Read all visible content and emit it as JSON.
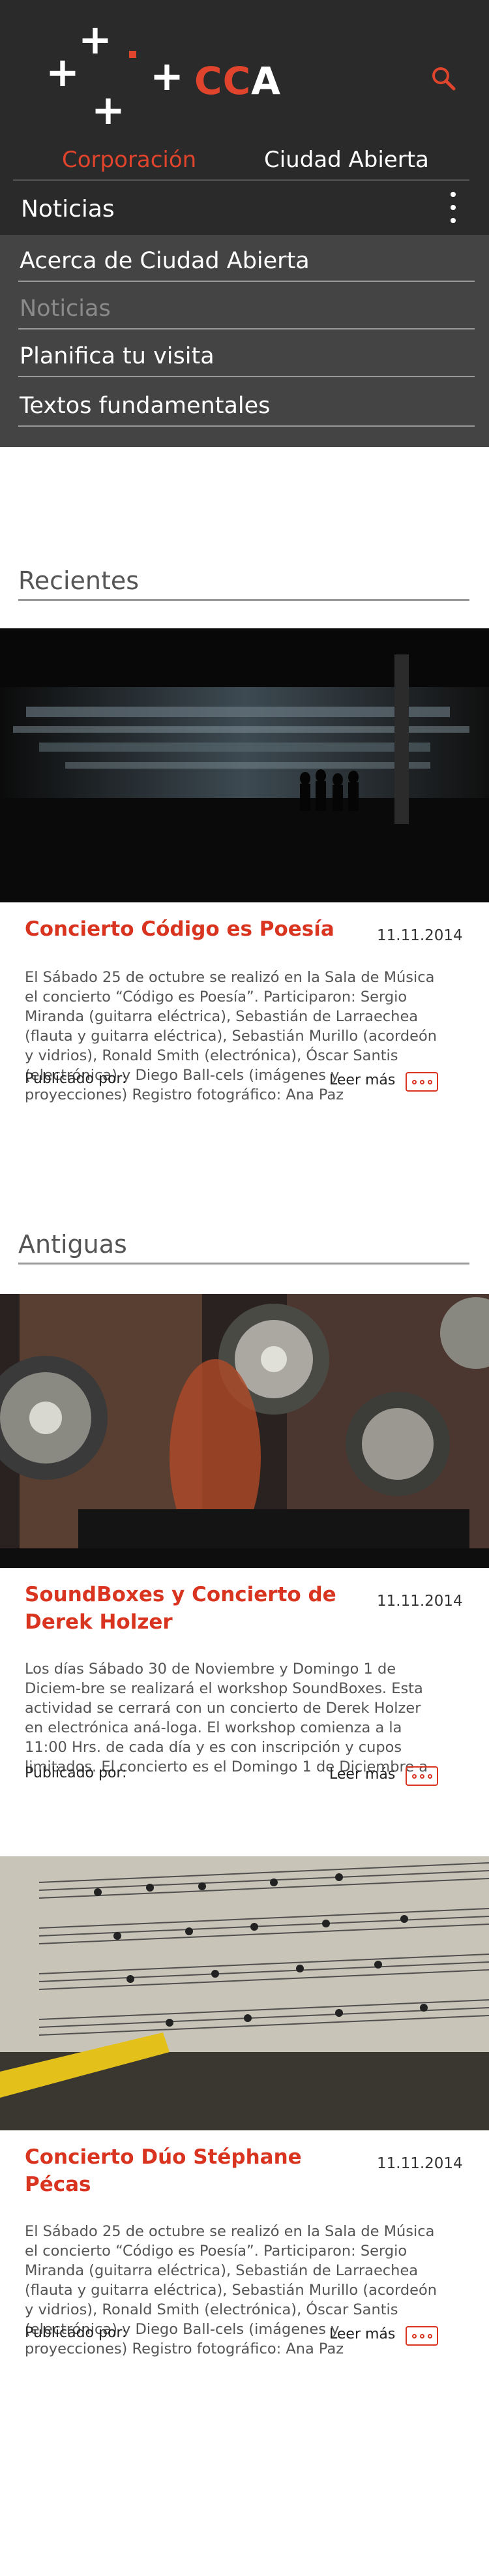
{
  "brand": {
    "logo_text_red": "CC",
    "logo_text_white": "A",
    "accent_color": "#e0442c"
  },
  "nav": {
    "tabs": [
      {
        "label": "Corporación"
      },
      {
        "label": "Ciudad Abierta"
      }
    ],
    "section_label": "Noticias",
    "menu": [
      {
        "label": "Acerca de Ciudad Abierta"
      },
      {
        "label": "Noticias"
      },
      {
        "label": "Planifica tu visita"
      },
      {
        "label": "Textos fundamentales"
      }
    ]
  },
  "groups": {
    "recent": "Recientes",
    "older": "Antiguas"
  },
  "posts": [
    {
      "title": "Concierto Código es Poesía",
      "date": "11.11.2014",
      "excerpt": "El Sábado 25 de octubre se realizó en la Sala de Música el concierto “Código es Poesía”. Participaron: Sergio Miranda (guitarra eléctrica), Sebastián de Larraechea (flauta y guitarra eléctrica), Sebastián Murillo (acordeón y vidrios), Ronald Smith (electrónica), Óscar Santis (electrónica) y Diego Ball-cels (imágenes y proyecciones) Registro fotográfico: Ana Paz",
      "published_label": "Publicado por:",
      "read_more": "Leer más",
      "image": "concert-silhouettes-photo"
    },
    {
      "title": "SoundBoxes y Concierto de Derek Holzer",
      "date": "11.11.2014",
      "excerpt": "Los días Sábado 30 de Noviembre y Domingo 1 de Diciem-bre se realizará el workshop SoundBoxes. Esta actividad se cerrará con un concierto de Derek Holzer en electrónica aná-loga. El workshop comienza a la 11:00 Hrs. de cada día y es con inscripción y cupos limitados. El concierto es el Domingo 1 de Diciembre a",
      "published_label": "Publicado por:",
      "read_more": "Leer más",
      "image": "soundboxes-speakers-photo"
    },
    {
      "title": "Concierto Dúo Stéphane Pécas",
      "date": "11.11.2014",
      "excerpt": "El Sábado 25 de octubre se realizó en la Sala de Música el concierto “Código es Poesía”. Participaron: Sergio Miranda (guitarra eléctrica), Sebastián de Larraechea (flauta y guitarra eléctrica), Sebastián Murillo (acordeón y vidrios), Ronald Smith (electrónica), Óscar Santis (electrónica) y Diego Ball-cels (imágenes y proyecciones) Registro fotográfico: Ana Paz",
      "published_label": "Publicado por:",
      "read_more": "Leer más",
      "image": "sheet-music-photo"
    }
  ]
}
